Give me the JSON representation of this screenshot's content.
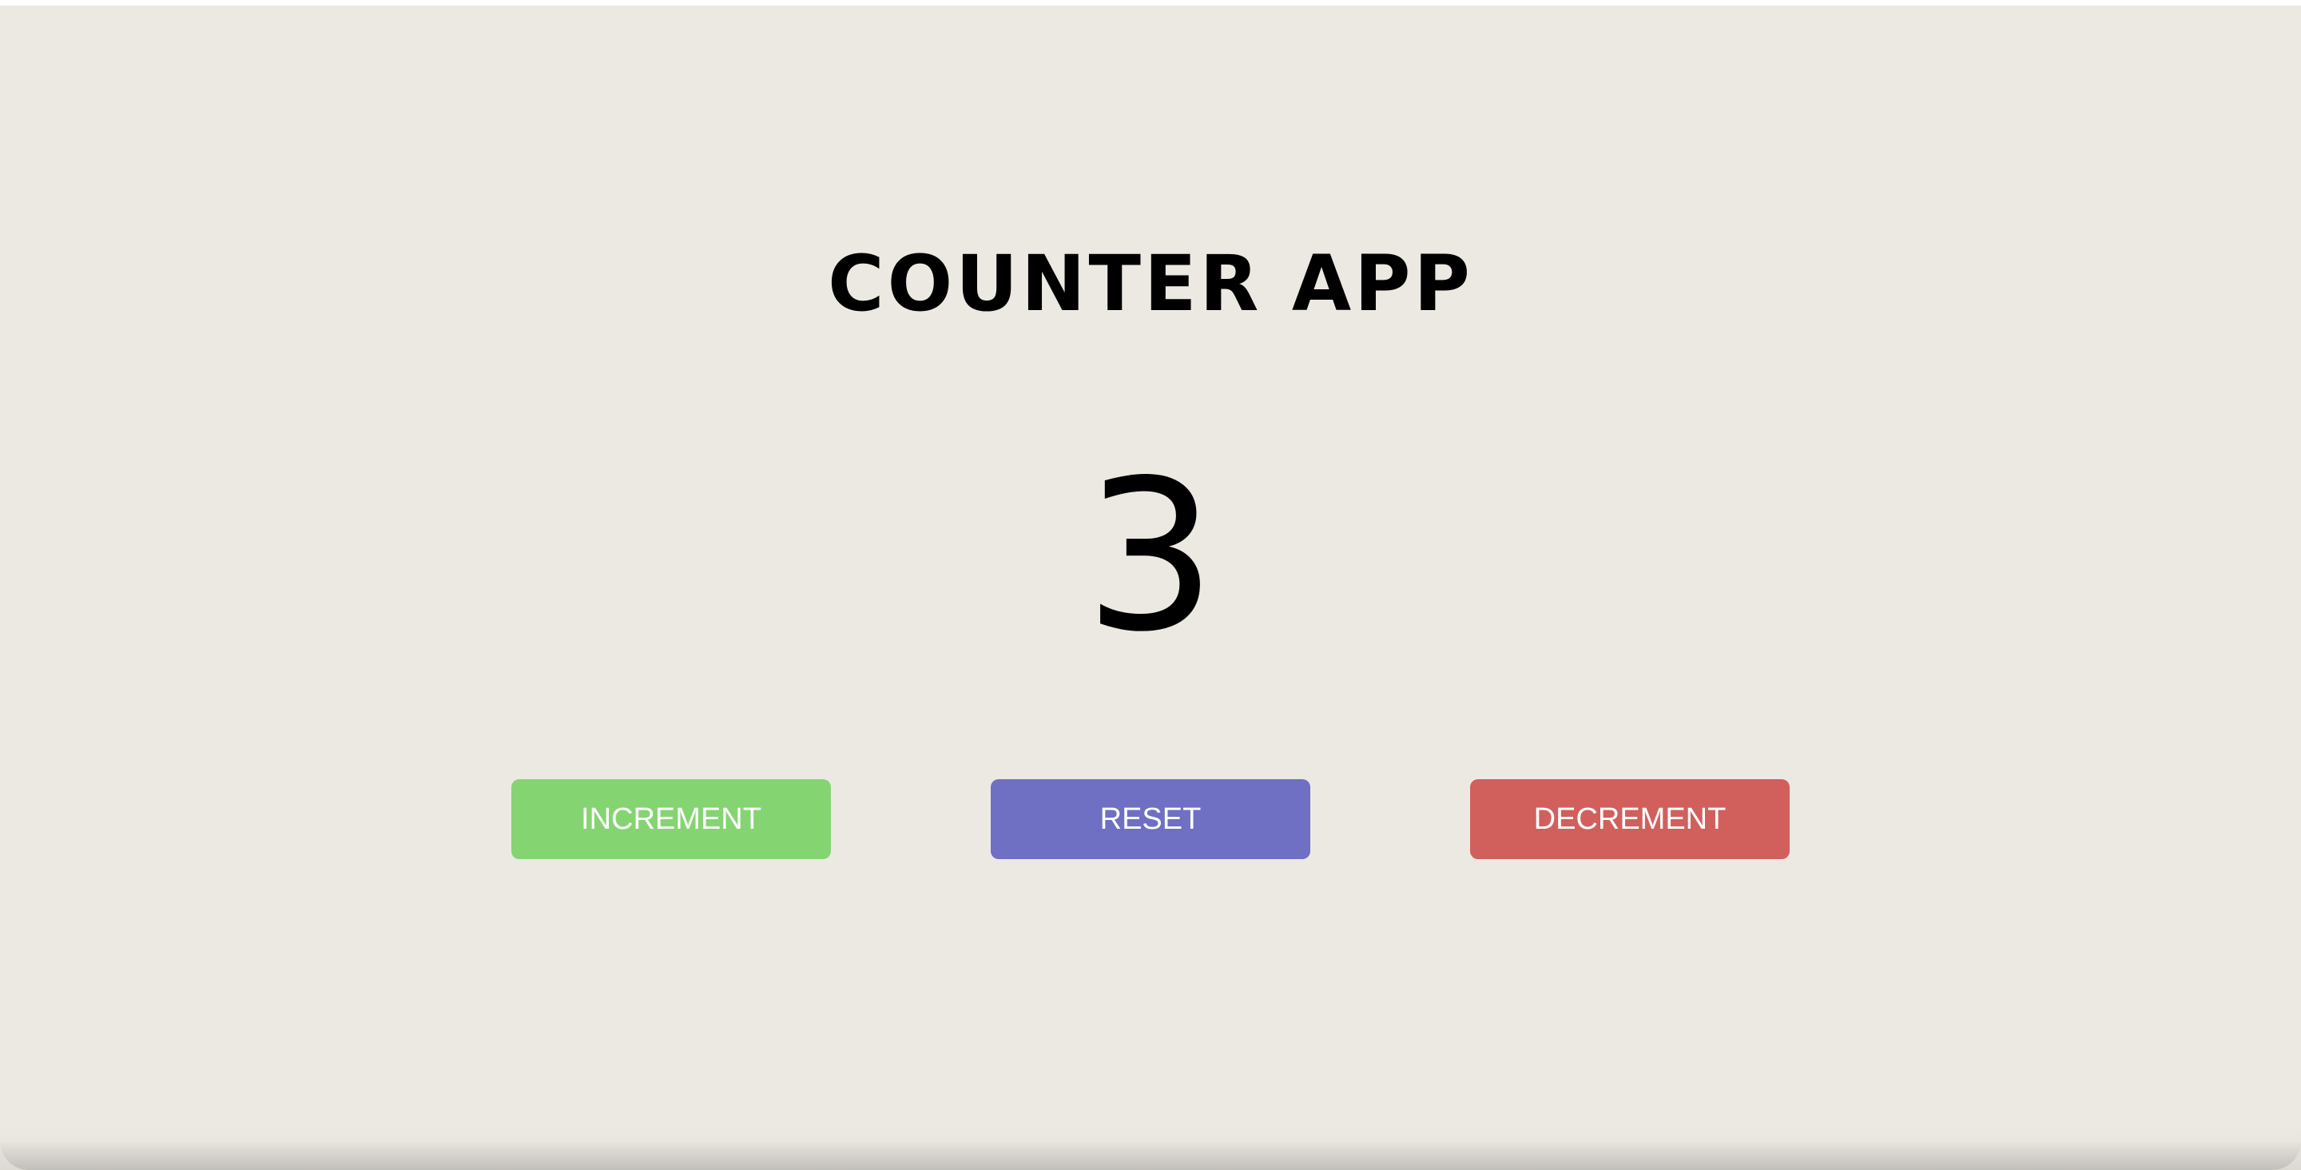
{
  "app": {
    "title": "COUNTER APP",
    "count": "3"
  },
  "buttons": {
    "increment": {
      "label": "INCREMENT",
      "color": "#84d572"
    },
    "reset": {
      "label": "RESET",
      "color": "#6f6fc4"
    },
    "decrement": {
      "label": "DECREMENT",
      "color": "#d1605d"
    }
  },
  "theme": {
    "background": "#ece9e3",
    "text": "#000000",
    "button_text": "#ffffff"
  }
}
